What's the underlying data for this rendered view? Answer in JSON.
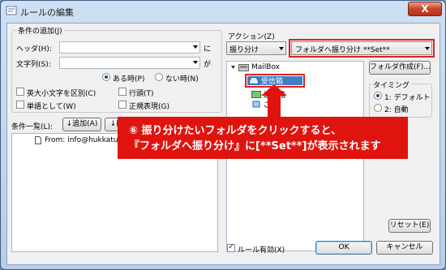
{
  "window": {
    "title": "ルールの編集",
    "close_label": "X"
  },
  "conditions": {
    "group_title": "条件の追加(J)",
    "header_label": "ヘッダ(H):",
    "header_value": "",
    "header_suffix": "に",
    "string_label": "文字列(S):",
    "string_value": "",
    "string_suffix": "が",
    "radio_exists": "ある時(P)",
    "radio_not_exists": "ない時(N)",
    "radio_selected": "ある時(P)",
    "cb_case": "英大小文字を区別(C)",
    "cb_line_head": "行頭(T)",
    "cb_word": "単語として(W)",
    "cb_regex": "正規表現(G)"
  },
  "condition_list": {
    "label": "条件一覧(L):",
    "add_button": "↓追加(A)",
    "delete_button": "↓削",
    "items": [
      "From: info@hukkatuai"
    ]
  },
  "action": {
    "label": "アクション(Z)",
    "type_value": "振り分け",
    "target_value": "フォルダへ振り分け **Set**",
    "create_folder_button": "フォルダ作成(F)...",
    "tree": {
      "root": "MailBox",
      "selected": "受信箱",
      "child2": "送信箱",
      "child3": "ご"
    }
  },
  "timing": {
    "title": "タイミング",
    "option1": "1: デフォルト",
    "option2": "2: 自動",
    "selected": "1: デフォルト"
  },
  "footer": {
    "reset_button": "リセット(E)",
    "rule_enabled": "ルール有効(X)",
    "ok_button": "OK",
    "cancel_button": "キャンセル"
  },
  "annotation": {
    "line1": "⑥ 振り分けたいフォルダをクリックすると、",
    "line2": "『フォルダへ振り分け』に[**Set**]が表示されます"
  },
  "colors": {
    "annotation_red": "#e0140f",
    "title_bar": "#cfe0f3",
    "highlight": "#e02020"
  }
}
